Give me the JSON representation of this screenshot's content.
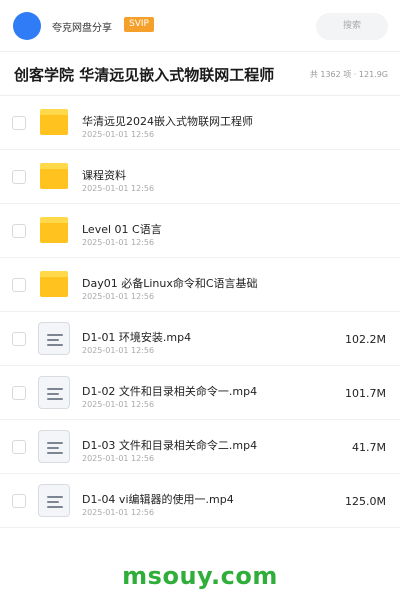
{
  "header": {
    "share_name": "夸克网盘分享",
    "badge": "SVIP",
    "search_label": "搜索",
    "avatar_color": "#2f7cf6"
  },
  "folder": {
    "title": "创客学院 华清远见嵌入式物联网工程师",
    "count": "共 1362 项 · 121.9G"
  },
  "files": [
    {
      "type": "folder",
      "icon": "folder-icon",
      "name": "华清远见2024嵌入式物联网工程师",
      "date": "2025-01-01 12:56",
      "size": ""
    },
    {
      "type": "folder",
      "icon": "folder-icon",
      "name": "课程资料",
      "date": "2025-01-01 12:56",
      "size": ""
    },
    {
      "type": "folder",
      "icon": "folder-icon",
      "name": "Level 01 C语言",
      "date": "2025-01-01 12:56",
      "size": ""
    },
    {
      "type": "folder",
      "icon": "folder-icon",
      "name": "Day01 必备Linux命令和C语言基础",
      "date": "2025-01-01 12:56",
      "size": ""
    },
    {
      "type": "video",
      "icon": "document-icon",
      "name": "D1-01 环境安装.mp4",
      "date": "2025-01-01 12:56",
      "size": "102.2M"
    },
    {
      "type": "video",
      "icon": "document-icon",
      "name": "D1-02 文件和目录相关命令一.mp4",
      "date": "2025-01-01 12:56",
      "size": "101.7M"
    },
    {
      "type": "video",
      "icon": "document-icon",
      "name": "D1-03 文件和目录相关命令二.mp4",
      "date": "2025-01-01 12:56",
      "size": "41.7M"
    },
    {
      "type": "video",
      "icon": "document-icon",
      "name": "D1-04 vi编辑器的使用一.mp4",
      "date": "2025-01-01 12:56",
      "size": "125.0M"
    }
  ],
  "watermark": "msouy.com",
  "colors": {
    "svip": "#f5a02a",
    "folder_tab": "#ffd94a",
    "folder_body": "#ffc21e",
    "watermark": "#2fae3a"
  }
}
